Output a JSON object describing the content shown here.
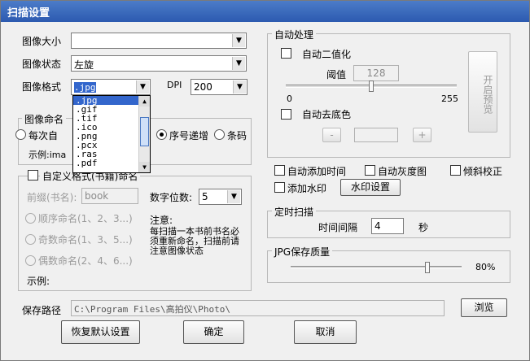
{
  "window": {
    "title": "扫描设置"
  },
  "image_size": {
    "label": "图像大小",
    "value": ""
  },
  "image_state": {
    "label": "图像状态",
    "value": "左旋"
  },
  "image_format": {
    "label": "图像格式",
    "value": ".jpg",
    "options": [
      ".jpg",
      ".gif",
      ".tif",
      ".ico",
      ".png",
      ".pcx",
      ".ras",
      ".pdf"
    ]
  },
  "dpi": {
    "label": "DPI",
    "value": "200"
  },
  "naming": {
    "group_title": "图像命名",
    "radio_each_time": "每次自",
    "radio_sequence": "序号递增",
    "radio_barcode": "条码",
    "example_label": "示例:ima"
  },
  "custom_naming": {
    "checkbox_label": "自定义格式(书籍)命名",
    "prefix_label": "前缀(书名):",
    "prefix_value": "book",
    "digits_label": "数字位数:",
    "digits_value": "5",
    "radio_sequential": "顺序命名(1、2、3...)",
    "radio_odd": "奇数命名(1、3、5...)",
    "radio_even": "偶数命名(2、4、6...)",
    "note_title": "注意:",
    "note_text": "每扫描一本书前书名必须重新命名，扫描前请注意图像状态",
    "example_label": "示例:"
  },
  "auto_process": {
    "group_title": "自动处理",
    "auto_binarize_label": "自动二值化",
    "threshold_label": "阈值",
    "threshold_value": "128",
    "slider_min": "0",
    "slider_max": "255",
    "threshold_fraction": 0.5,
    "auto_bg_label": "自动去底色",
    "minus": "-",
    "plus": "+",
    "preview_button": "开启预览"
  },
  "options": {
    "add_time": "自动添加时间",
    "auto_gray": "自动灰度图",
    "deskew": "倾斜校正",
    "add_watermark": "添加水印",
    "watermark_button": "水印设置"
  },
  "timer": {
    "group_title": "定时扫描",
    "interval_label": "时间间隔",
    "interval_value": "4",
    "unit": "秒"
  },
  "jpg_quality": {
    "group_title": "JPG保存质量",
    "value_label": "80%",
    "fraction": 0.8
  },
  "save_path": {
    "label": "保存路径",
    "value": "C:\\Program Files\\高拍仪\\Photo\\",
    "browse_button": "浏览"
  },
  "footer": {
    "restore_button": "恢复默认设置",
    "ok_button": "确定",
    "cancel_button": "取消"
  }
}
